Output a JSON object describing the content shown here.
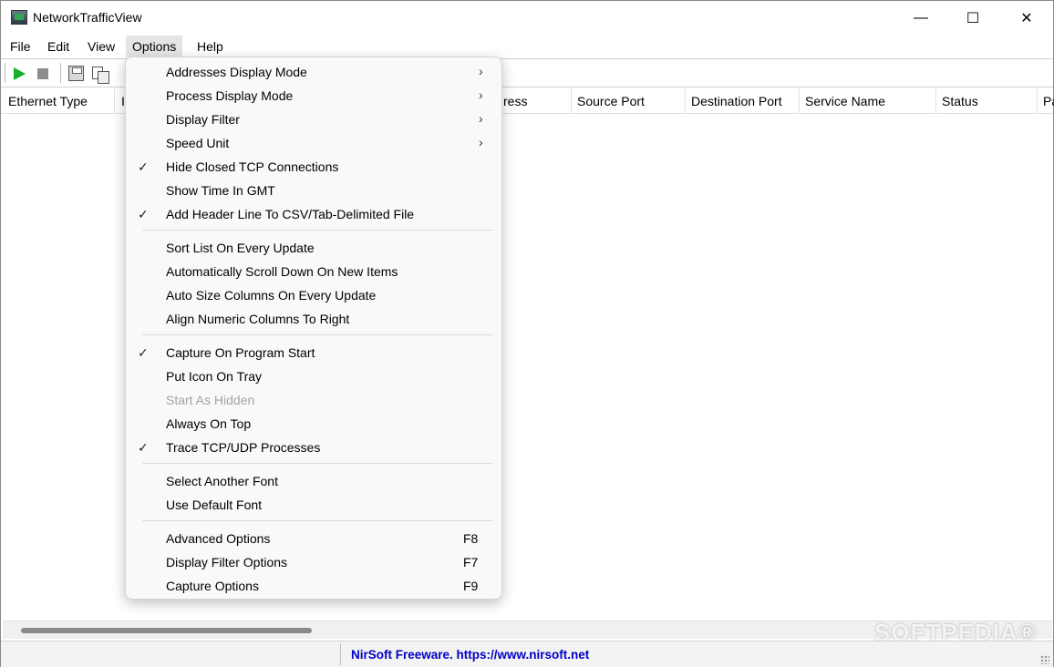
{
  "window": {
    "title": "NetworkTrafficView"
  },
  "menubar": {
    "file": "File",
    "edit": "Edit",
    "view": "View",
    "options": "Options",
    "help": "Help"
  },
  "columns": [
    "Ethernet Type",
    "I",
    "ress",
    "Source Port",
    "Destination Port",
    "Service Name",
    "Status",
    "Pa"
  ],
  "options_menu": {
    "addresses_display_mode": "Addresses Display Mode",
    "process_display_mode": "Process Display Mode",
    "display_filter": "Display Filter",
    "speed_unit": "Speed Unit",
    "hide_closed_tcp": "Hide Closed TCP Connections",
    "show_time_gmt": "Show Time In GMT",
    "add_header_line": "Add Header Line To CSV/Tab-Delimited File",
    "sort_list": "Sort List On Every Update",
    "auto_scroll": "Automatically Scroll Down On New Items",
    "auto_size": "Auto Size Columns On Every Update",
    "align_numeric": "Align Numeric Columns To Right",
    "capture_on_start": "Capture On Program Start",
    "put_icon_tray": "Put Icon On Tray",
    "start_hidden": "Start As Hidden",
    "always_on_top": "Always On Top",
    "trace_processes": "Trace TCP/UDP Processes",
    "select_font": "Select Another Font",
    "default_font": "Use Default Font",
    "advanced_options": "Advanced Options",
    "advanced_options_key": "F8",
    "display_filter_options": "Display Filter Options",
    "display_filter_options_key": "F7",
    "capture_options": "Capture Options",
    "capture_options_key": "F9",
    "checked": [
      "hide_closed_tcp",
      "add_header_line",
      "capture_on_start",
      "trace_processes"
    ],
    "disabled": [
      "start_hidden"
    ]
  },
  "statusbar": {
    "link": "NirSoft Freeware. https://www.nirsoft.net"
  },
  "watermark": "SOFTPEDIA®",
  "icons": {
    "play": "play-icon",
    "stop": "stop-icon",
    "save": "save-icon",
    "copy": "copy-icon"
  },
  "colors": {
    "accent_link": "#0000c8",
    "play_green": "#17b02a"
  }
}
